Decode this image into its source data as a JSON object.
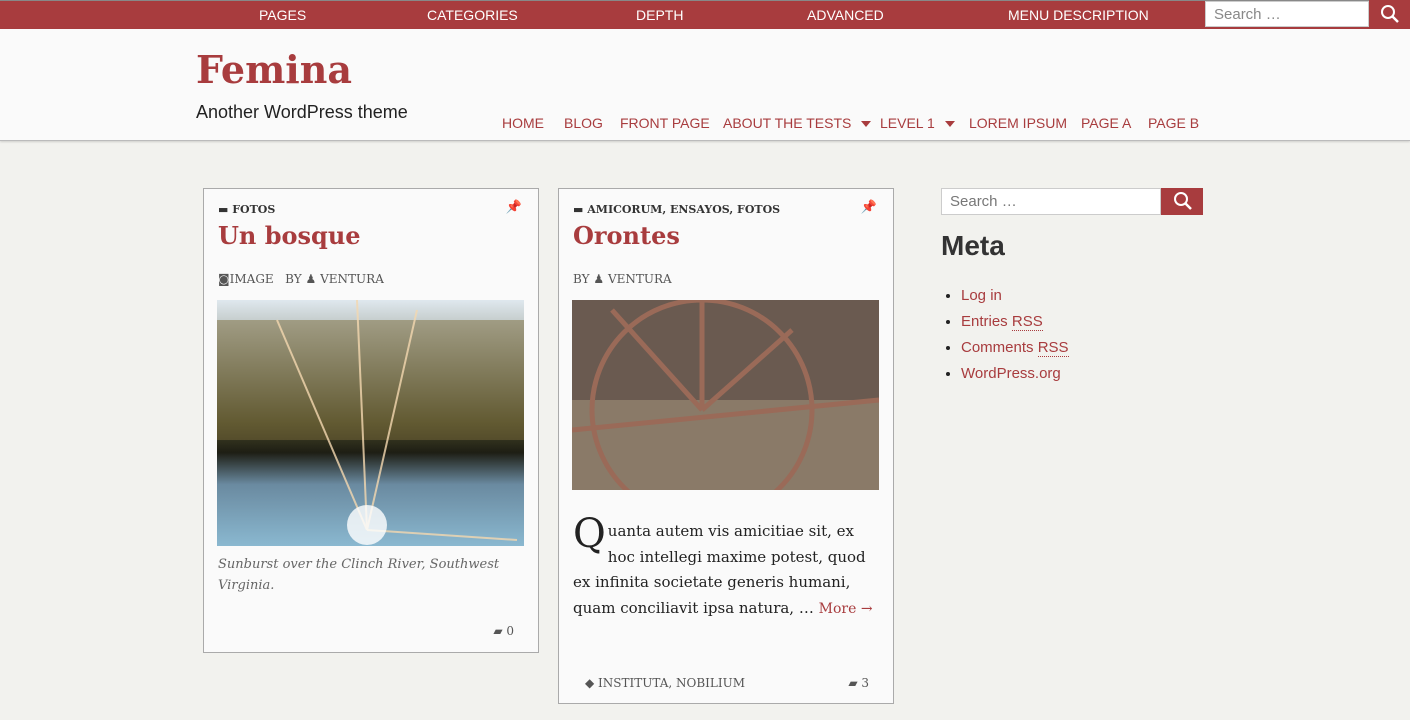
{
  "top_menu": {
    "items": [
      "PAGES",
      "CATEGORIES",
      "DEPTH",
      "ADVANCED",
      "MENU DESCRIPTION"
    ],
    "search_placeholder": "Search …"
  },
  "site": {
    "title": "Femina",
    "tagline": "Another WordPress theme"
  },
  "nav": {
    "items": [
      "HOME",
      "BLOG",
      "FRONT PAGE",
      "ABOUT THE TESTS",
      "LEVEL 1",
      "LOREM IPSUM",
      "PAGE A",
      "PAGE B"
    ]
  },
  "posts": [
    {
      "categories": "FOTOS",
      "title": "Un bosque",
      "format": "IMAGE",
      "by": "BY",
      "author": "VENTURA",
      "caption": "Sunburst over the Clinch River, Southwest Virginia.",
      "comments": "0"
    },
    {
      "categories": "AMICORUM, ENSAYOS, FOTOS",
      "title": "Orontes",
      "by": "BY",
      "author": "VENTURA",
      "dropcap": "Q",
      "excerpt": "uanta autem vis amicitiae sit, ex hoc intellegi maxime potest, quod ex infinita societate generis humani, quam conciliavit ipsa natura, …",
      "more": "More →",
      "tags": "INSTITUTA, NOBILIUM",
      "comments": "3"
    }
  ],
  "sidebar": {
    "search_placeholder": "Search …",
    "meta_title": "Meta",
    "links": [
      {
        "pre": "Log in",
        "abbr": ""
      },
      {
        "pre": "Entries ",
        "abbr": "RSS"
      },
      {
        "pre": "Comments ",
        "abbr": "RSS"
      },
      {
        "pre": "WordPress.org",
        "abbr": ""
      }
    ]
  },
  "colors": {
    "accent": "#a83c3e",
    "background": "#f2f2ee"
  }
}
